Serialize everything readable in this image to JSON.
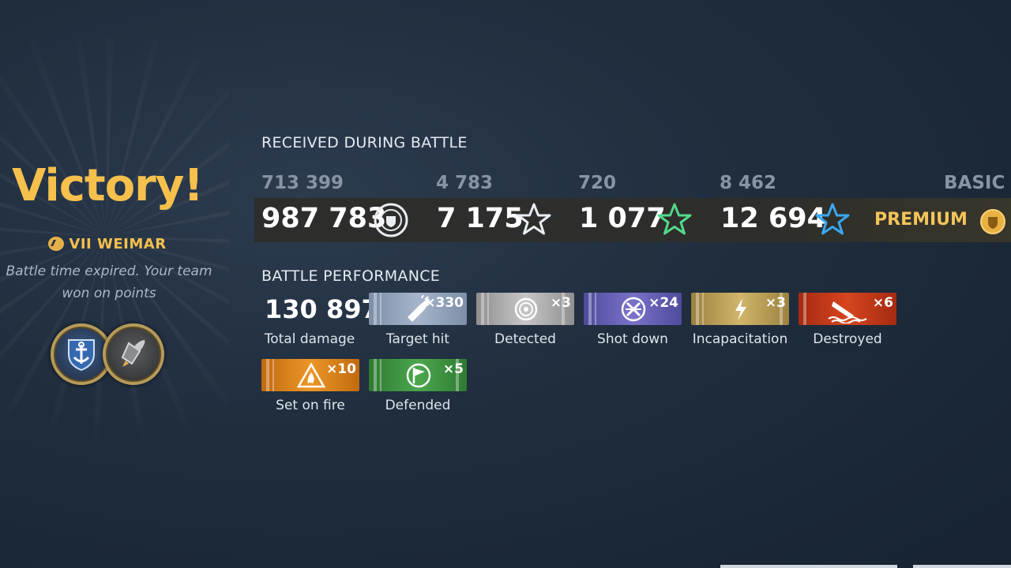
{
  "result": {
    "title": "Victory!",
    "ship_name": "VII WEIMAR",
    "reason": "Battle time expired. Your team won on points"
  },
  "medals": [
    {
      "icon": "anchor-shield-icon"
    },
    {
      "icon": "shell-icon"
    }
  ],
  "received": {
    "title": "RECEIVED DURING BATTLE",
    "basic_label": "BASIC",
    "premium_label": "PREMIUM",
    "basic": [
      "713 399",
      "4 783",
      "720",
      "8 462"
    ],
    "premium": [
      "987 783",
      "7 175",
      "1 077",
      "12 694"
    ],
    "icons": [
      "credits-icon",
      "base-xp-star-icon",
      "commander-xp-star-icon",
      "free-xp-star-icon"
    ],
    "colors": {
      "star_white": "#e8edf2",
      "star_green": "#53d98a",
      "star_blue": "#3aa8f2",
      "premium": "#f4c45b"
    }
  },
  "performance": {
    "title": "BATTLE PERFORMANCE",
    "total_damage_value": "130 897",
    "total_damage_label": "Total damage",
    "ribbons": [
      {
        "label": "Target hit",
        "count": "×330",
        "color": "#9aaac0"
      },
      {
        "label": "Detected",
        "count": "×3",
        "color": "#b5b5b5"
      },
      {
        "label": "Shot down",
        "count": "×24",
        "color": "#6c63b8"
      },
      {
        "label": "Incapacitation",
        "count": "×3",
        "color": "#c3a65c"
      },
      {
        "label": "Destroyed",
        "count": "×6",
        "color": "#c93c1a"
      },
      {
        "label": "Set on fire",
        "count": "×10",
        "color": "#e08a1f"
      },
      {
        "label": "Defended",
        "count": "×5",
        "color": "#3f9342"
      }
    ]
  }
}
